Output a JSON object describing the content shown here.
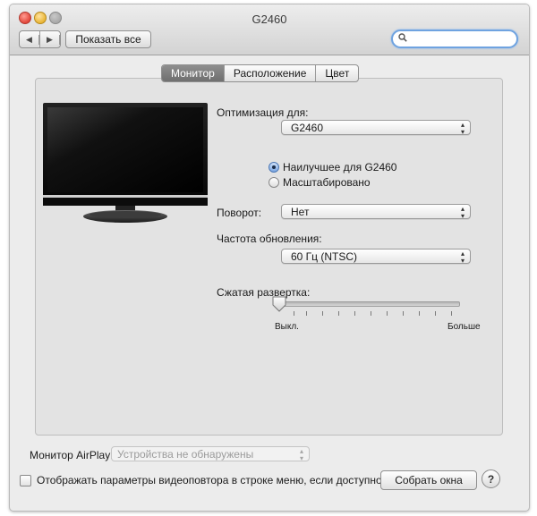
{
  "window": {
    "title": "G2460"
  },
  "toolbar": {
    "back_icon": "◀",
    "forward_icon": "▶",
    "show_all_label": "Показать все",
    "search_placeholder": ""
  },
  "tabs": [
    {
      "label": "Монитор",
      "active": true
    },
    {
      "label": "Расположение",
      "active": false
    },
    {
      "label": "Цвет",
      "active": false
    }
  ],
  "monitor": {
    "optimize_label": "Оптимизация для:",
    "optimize_value": "G2460",
    "radio_best_label": "Наилучшее для G2460",
    "radio_best_selected": true,
    "radio_scaled_label": "Масштабировано",
    "radio_scaled_selected": false,
    "rotation_label": "Поворот:",
    "rotation_value": "Нет",
    "refresh_label": "Частота обновления:",
    "refresh_value": "60 Гц (NTSC)",
    "underscan_label": "Сжатая развертка:",
    "underscan_value": 0,
    "underscan_min_label": "Выкл.",
    "underscan_max_label": "Больше"
  },
  "airplay": {
    "label": "Монитор AirPlay:",
    "value": "Устройства не обнаружены",
    "enabled": false
  },
  "footer": {
    "mirror_checkbox_label": "Отображать параметры видеоповтора в строке меню, если доступно",
    "mirror_checked": false,
    "gather_button_label": "Собрать окна",
    "help_label": "?"
  },
  "colors": {
    "accent": "#6fa3e0",
    "active_tab": "#7d7d7d",
    "window_bg": "#ececec"
  }
}
